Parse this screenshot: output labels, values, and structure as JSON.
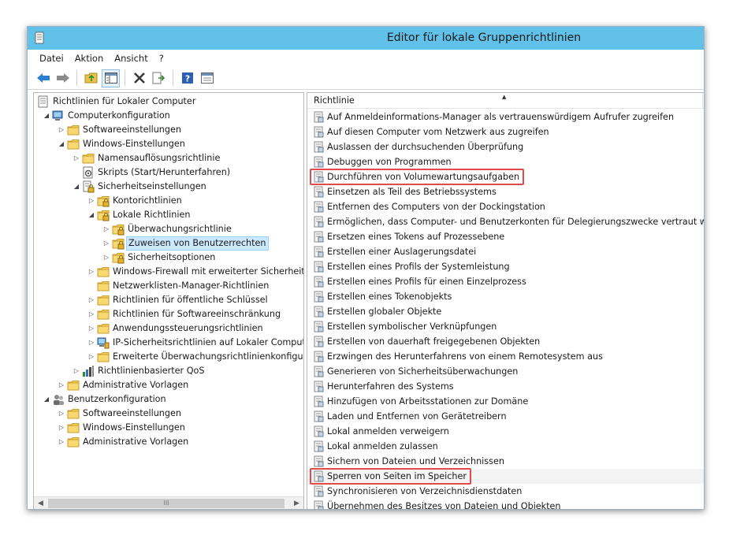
{
  "window": {
    "title": "Editor für lokale Gruppenrichtlinien"
  },
  "menu": [
    "Datei",
    "Aktion",
    "Ansicht",
    "?"
  ],
  "toolbar": {
    "buttons": [
      "back-icon",
      "forward-icon",
      "up-folder-icon",
      "show-hide-tree-icon",
      "delete-icon",
      "export-list-icon",
      "help-icon",
      "properties-view-icon"
    ]
  },
  "tree": [
    {
      "label": "Richtlinien für Lokaler Computer",
      "level": 0,
      "expander": "",
      "icon": "policy-doc"
    },
    {
      "label": "Computerkonfiguration",
      "level": 1,
      "expander": "open",
      "icon": "computer"
    },
    {
      "label": "Softwareeinstellungen",
      "level": 2,
      "expander": "closed",
      "icon": "folder"
    },
    {
      "label": "Windows-Einstellungen",
      "level": 2,
      "expander": "open",
      "icon": "folder"
    },
    {
      "label": "Namensauflösungsrichtlinie",
      "level": 3,
      "expander": "closed",
      "icon": "folder"
    },
    {
      "label": "Skripts (Start/Herunterfahren)",
      "level": 3,
      "expander": "",
      "icon": "script"
    },
    {
      "label": "Sicherheitseinstellungen",
      "level": 3,
      "expander": "open",
      "icon": "security"
    },
    {
      "label": "Kontorichtlinien",
      "level": 4,
      "expander": "closed",
      "icon": "lock-folder"
    },
    {
      "label": "Lokale Richtlinien",
      "level": 4,
      "expander": "open",
      "icon": "lock-folder"
    },
    {
      "label": "Überwachungsrichtlinie",
      "level": 5,
      "expander": "closed",
      "icon": "lock-folder"
    },
    {
      "label": "Zuweisen von Benutzerrechten",
      "level": 5,
      "expander": "closed",
      "icon": "lock-folder",
      "selected": true
    },
    {
      "label": "Sicherheitsoptionen",
      "level": 5,
      "expander": "closed",
      "icon": "lock-folder"
    },
    {
      "label": "Windows-Firewall mit erweiterter Sicherheit",
      "level": 4,
      "expander": "closed",
      "icon": "folder"
    },
    {
      "label": "Netzwerklisten-Manager-Richtlinien",
      "level": 4,
      "expander": "",
      "icon": "folder"
    },
    {
      "label": "Richtlinien für öffentliche Schlüssel",
      "level": 4,
      "expander": "closed",
      "icon": "folder"
    },
    {
      "label": "Richtlinien für Softwareeinschränkung",
      "level": 4,
      "expander": "closed",
      "icon": "folder"
    },
    {
      "label": "Anwendungssteuerungsrichtlinien",
      "level": 4,
      "expander": "closed",
      "icon": "folder"
    },
    {
      "label": "IP-Sicherheitsrichtlinien auf Lokaler Compute",
      "level": 4,
      "expander": "closed",
      "icon": "ipsec"
    },
    {
      "label": "Erweiterte Überwachungsrichtlinienkonfigurat",
      "level": 4,
      "expander": "closed",
      "icon": "folder"
    },
    {
      "label": "Richtlinienbasierter QoS",
      "level": 3,
      "expander": "closed",
      "icon": "qos"
    },
    {
      "label": "Administrative Vorlagen",
      "level": 2,
      "expander": "closed",
      "icon": "folder"
    },
    {
      "label": "Benutzerkonfiguration",
      "level": 1,
      "expander": "open",
      "icon": "users"
    },
    {
      "label": "Softwareeinstellungen",
      "level": 2,
      "expander": "closed",
      "icon": "folder"
    },
    {
      "label": "Windows-Einstellungen",
      "level": 2,
      "expander": "closed",
      "icon": "folder"
    },
    {
      "label": "Administrative Vorlagen",
      "level": 2,
      "expander": "closed",
      "icon": "folder"
    }
  ],
  "tree_scroll": {
    "thumb_glyph": "III",
    "left": "◀",
    "right": "▶"
  },
  "list": {
    "column": "Richtlinie",
    "sort_glyph": "▲",
    "items": [
      {
        "label": "Auf Anmeldeinformations-Manager als vertrauenswürdigem Aufrufer zugreifen"
      },
      {
        "label": "Auf diesen Computer vom Netzwerk aus zugreifen"
      },
      {
        "label": "Auslassen der durchsuchenden Überprüfung"
      },
      {
        "label": "Debuggen von Programmen"
      },
      {
        "label": "Durchführen von Volumewartungsaufgaben",
        "highlighted": true
      },
      {
        "label": "Einsetzen als Teil des Betriebssystems"
      },
      {
        "label": "Entfernen des Computers von der Dockingstation"
      },
      {
        "label": "Ermöglichen, dass Computer- und Benutzerkonten für Delegierungszwecke vertraut wird"
      },
      {
        "label": "Ersetzen eines Tokens auf Prozessebene"
      },
      {
        "label": "Erstellen einer Auslagerungsdatei"
      },
      {
        "label": "Erstellen eines Profils der Systemleistung"
      },
      {
        "label": "Erstellen eines Profils für einen Einzelprozess"
      },
      {
        "label": "Erstellen eines Tokenobjekts"
      },
      {
        "label": "Erstellen globaler Objekte"
      },
      {
        "label": "Erstellen symbolischer Verknüpfungen"
      },
      {
        "label": "Erstellen von dauerhaft freigegebenen Objekten"
      },
      {
        "label": "Erzwingen des Herunterfahrens von einem Remotesystem aus"
      },
      {
        "label": "Generieren von Sicherheitsüberwachungen"
      },
      {
        "label": "Herunterfahren des Systems"
      },
      {
        "label": "Hinzufügen von Arbeitsstationen zur Domäne"
      },
      {
        "label": "Laden und Entfernen von Gerätetreibern"
      },
      {
        "label": "Lokal anmelden verweigern"
      },
      {
        "label": "Lokal anmelden zulassen"
      },
      {
        "label": "Sichern von Dateien und Verzeichnissen"
      },
      {
        "label": "Sperren von Seiten im Speicher",
        "highlighted": true,
        "hover": true
      },
      {
        "label": "Synchronisieren von Verzeichnisdienstdaten"
      },
      {
        "label": "Übernehmen des Besitzes von Dateien und Objekten"
      }
    ]
  },
  "colors": {
    "titlebar": "#62c1e9",
    "selection": "#cce8ff",
    "highlight_box": "#e24b4b",
    "folder": "#f5cd5b"
  }
}
